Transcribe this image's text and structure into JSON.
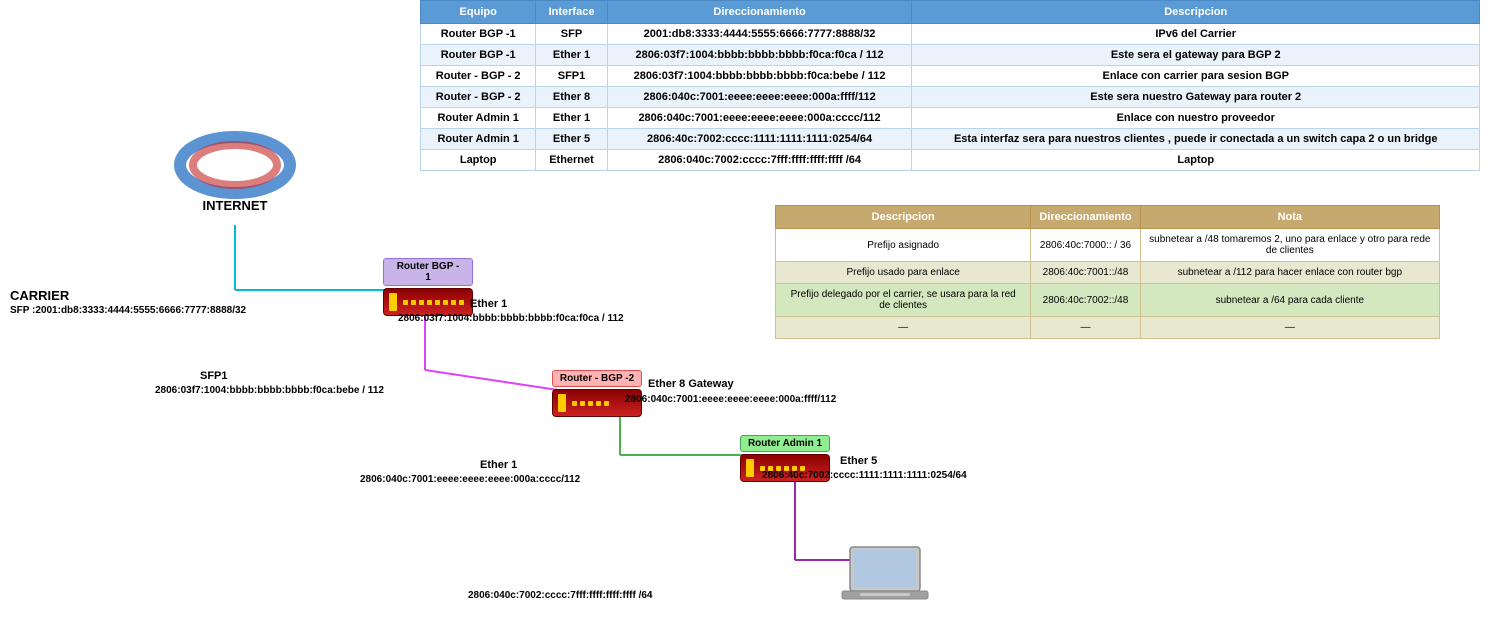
{
  "table": {
    "headers": [
      "Equipo",
      "Interface",
      "Direccionamiento",
      "Descripcion"
    ],
    "rows": [
      {
        "equipo": "Router BGP -1",
        "interface": "SFP",
        "direccionamiento": "2001:db8:3333:4444:5555:6666:7777:8888/32",
        "descripcion": "IPv6 del Carrier"
      },
      {
        "equipo": "Router BGP -1",
        "interface": "Ether 1",
        "direccionamiento": "2806:03f7:1004:bbbb:bbbb:bbbb:f0ca:f0ca / 112",
        "descripcion": "Este sera el gateway para BGP 2"
      },
      {
        "equipo": "Router - BGP - 2",
        "interface": "SFP1",
        "direccionamiento": "2806:03f7:1004:bbbb:bbbb:bbbb:f0ca:bebe / 112",
        "descripcion": "Enlace con carrier para sesion BGP"
      },
      {
        "equipo": "Router - BGP - 2",
        "interface": "Ether 8",
        "direccionamiento": "2806:040c:7001:eeee:eeee:eeee:000a:ffff/112",
        "descripcion": "Este sera nuestro Gateway para router 2"
      },
      {
        "equipo": "Router Admin 1",
        "interface": "Ether 1",
        "direccionamiento": "2806:040c:7001:eeee:eeee:eeee:000a:cccc/112",
        "descripcion": "Enlace con nuestro proveedor"
      },
      {
        "equipo": "Router Admin 1",
        "interface": "Ether 5",
        "direccionamiento": "2806:40c:7002:cccc:1111:1111:1111:0254/64",
        "descripcion": "Esta interfaz sera para nuestros clientes , puede ir conectada a un switch capa 2 o un bridge"
      },
      {
        "equipo": "Laptop",
        "interface": "Ethernet",
        "direccionamiento": "2806:040c:7002:cccc:7fff:ffff:ffff:ffff /64",
        "descripcion": "Laptop"
      }
    ]
  },
  "second_table": {
    "headers": [
      "Descripcion",
      "Direccionamiento",
      "Nota"
    ],
    "rows": [
      {
        "descripcion": "Prefijo asignado",
        "direccionamiento": "2806:40c:7000:: / 36",
        "nota": "subnetear a /48  tomaremos 2, uno para enlace y otro para rede de clientes"
      },
      {
        "descripcion": "Prefijo usado para enlace",
        "direccionamiento": "2806:40c:7001::/48",
        "nota": "subnetear a /112 para hacer enlace con router bgp"
      },
      {
        "descripcion": "Prefijo delegado por el carrier, se usara para la red de clientes",
        "direccionamiento": "2806:40c:7002::/48",
        "nota": "subnetear a /64 para cada cliente"
      },
      {
        "descripcion": "—",
        "direccionamiento": "—",
        "nota": "—"
      }
    ]
  },
  "diagram": {
    "internet_label": "INTERNET",
    "carrier_label": "CARRIER",
    "carrier_sfp": "SFP :2001:db8:3333:4444:5555:6666:7777:8888/32",
    "router_bgp1_label": "Router BGP -\n1",
    "router_bgp2_label": "Router - BGP -2",
    "router_admin1_label": "Router Admin 1",
    "ether1_bgp1_label": "Ether 1",
    "ether1_bgp1_addr": "2806:03f7:1004:bbbb:bbbb:bbbb:f0ca:f0ca / 112",
    "sfp1_bgp2_label": "SFP1",
    "sfp1_bgp2_addr": "2806:03f7:1004:bbbb:bbbb:bbbb:f0ca:bebe / 112",
    "ether8_bgp2_label": "Ether 8 Gateway",
    "ether8_bgp2_addr": "2806:040c:7001:eeee:eeee:eeee:000a:ffff/112",
    "ether1_admin1_label": "Ether 1",
    "ether1_admin1_addr": "2806:040c:7001:eeee:eeee:eeee:000a:cccc/112",
    "ether5_admin1_label": "Ether 5",
    "ether5_admin1_addr": "2806:40c:7002:cccc:1111:1111:1111:0254/64",
    "laptop_addr": "2806:040c:7002:cccc:7fff:ffff:ffff:ffff /64"
  }
}
